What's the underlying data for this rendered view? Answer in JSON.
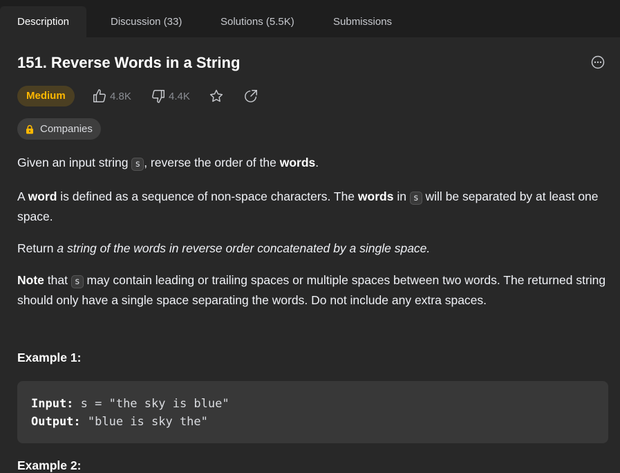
{
  "tabs": [
    {
      "label": "Description"
    },
    {
      "label": "Discussion (33)"
    },
    {
      "label": "Solutions (5.5K)"
    },
    {
      "label": "Submissions"
    }
  ],
  "problem": {
    "title": "151. Reverse Words in a String",
    "difficulty": "Medium",
    "likes": "4.8K",
    "dislikes": "4.4K",
    "companies_label": "Companies"
  },
  "description": {
    "p1_a": "Given an input string ",
    "p1_code": "s",
    "p1_b": ", reverse the order of the ",
    "p1_bold": "words",
    "p1_c": ".",
    "p2_a": "A ",
    "p2_bold1": "word",
    "p2_b": " is defined as a sequence of non-space characters. The ",
    "p2_bold2": "words",
    "p2_c": " in ",
    "p2_code": "s",
    "p2_d": " will be separated by at least one space.",
    "p3_a": "Return ",
    "p3_italic": "a string of the words in reverse order concatenated by a single space.",
    "p4_bold": "Note",
    "p4_a": " that ",
    "p4_code": "s",
    "p4_b": " may contain leading or trailing spaces or multiple spaces between two words. The returned string should only have a single space separating the words. Do not include any extra spaces."
  },
  "examples": [
    {
      "title": "Example 1:",
      "input_label": "Input:",
      "input_value": " s = \"the sky is blue\"",
      "output_label": "Output:",
      "output_value": " \"blue is sky the\""
    },
    {
      "title": "Example 2:"
    }
  ],
  "icons": {
    "like": "thumbs-up-icon",
    "dislike": "thumbs-down-icon",
    "favorite": "star-icon",
    "share": "share-icon",
    "more": "more-options-icon",
    "lock": "lock-icon"
  },
  "colors": {
    "medium": "#ffb800",
    "background": "#282828",
    "tabbar": "#1e1e1e"
  }
}
